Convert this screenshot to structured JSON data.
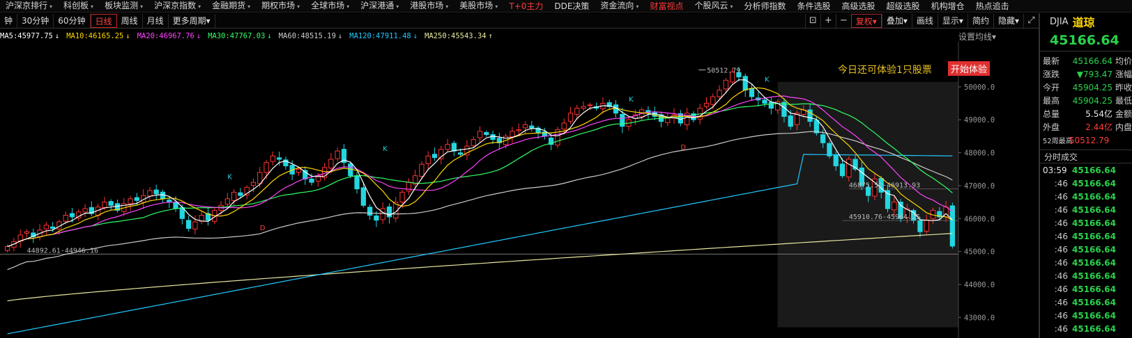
{
  "menu": [
    {
      "label": "沪深京排行",
      "caret": true
    },
    {
      "label": "科创板",
      "caret": true
    },
    {
      "label": "板块监测",
      "caret": true
    },
    {
      "label": "沪深京指数",
      "caret": true
    },
    {
      "label": "金融期货",
      "caret": true
    },
    {
      "label": "期权市场",
      "caret": true
    },
    {
      "label": "全球市场",
      "caret": true
    },
    {
      "label": "沪深港通",
      "caret": true
    },
    {
      "label": "港股市场",
      "caret": true
    },
    {
      "label": "美股市场",
      "caret": true
    },
    {
      "label": "T+0主力",
      "caret": false,
      "red": true
    },
    {
      "label": "DDE决策",
      "caret": false
    },
    {
      "label": "资金流向",
      "caret": true
    },
    {
      "label": "财富视点",
      "caret": false,
      "red": true
    },
    {
      "label": "个股风云",
      "caret": true
    },
    {
      "label": "分析师指数",
      "caret": false
    },
    {
      "label": "条件选股",
      "caret": false
    },
    {
      "label": "高级选股",
      "caret": false
    },
    {
      "label": "超级选股",
      "caret": false
    },
    {
      "label": "机构增仓",
      "caret": false
    },
    {
      "label": "热点追击",
      "caret": false
    }
  ],
  "toolbar": {
    "periods": [
      "钟",
      "30分钟",
      "60分钟",
      "日线",
      "周线",
      "月线",
      "更多周期"
    ],
    "active_period": "日线",
    "more_caret": "▾",
    "tools": [
      "复权",
      "叠加",
      "画线",
      "显示",
      "简约",
      "隐藏"
    ],
    "icons": {
      "lock": "⊡",
      "plus": "+",
      "minus": "−",
      "expand": "⤢"
    }
  },
  "ma_legend": [
    {
      "label": "MA5:45977.75",
      "arrow": "↓",
      "color": "#ffffff"
    },
    {
      "label": "MA10:46165.25",
      "arrow": "↓",
      "color": "#ffd700"
    },
    {
      "label": "MA20:46967.76",
      "arrow": "↓",
      "color": "#ff44ff"
    },
    {
      "label": "MA30:47767.03",
      "arrow": "↓",
      "color": "#33ff66"
    },
    {
      "label": "MA60:48515.19",
      "arrow": "↓",
      "color": "#cccccc"
    },
    {
      "label": "MA120:47911.48",
      "arrow": "↓",
      "color": "#22c8ff"
    },
    {
      "label": "MA250:45543.34",
      "arrow": "↑",
      "color": "#e8e8a0"
    }
  ],
  "ma_settings": "设置均线▾",
  "promo": {
    "text": "今日还可体验1只股票",
    "button": "开始体验"
  },
  "right_panel": {
    "code": "DJIA",
    "name": "道琼",
    "price": "45166.64",
    "stats": [
      {
        "label": "最新",
        "value": "45166.64",
        "color": "green",
        "next": "均价"
      },
      {
        "label": "涨跌",
        "value": "▼793.47",
        "color": "green",
        "next": "涨幅"
      },
      {
        "label": "今开",
        "value": "45904.25",
        "color": "green",
        "next": "昨收"
      },
      {
        "label": "最高",
        "value": "45904.25",
        "color": "green",
        "next": "最低"
      },
      {
        "label": "总量",
        "value": "5.54亿",
        "color": "white",
        "next": "金额"
      },
      {
        "label": "外盘",
        "value": "2.44亿",
        "color": "red",
        "next": "内盘"
      },
      {
        "label": "52周最高",
        "value": "50512.79",
        "color": "red",
        "next": ""
      }
    ],
    "ticks_title": "分时成交",
    "ticks": [
      {
        "time": "03:59",
        "price": "45166.64"
      },
      {
        "time": ":46",
        "price": "45166.64"
      },
      {
        "time": ":46",
        "price": "45166.64"
      },
      {
        "time": ":46",
        "price": "45166.64"
      },
      {
        "time": ":46",
        "price": "45166.64"
      },
      {
        "time": ":46",
        "price": "45166.64"
      },
      {
        "time": ":46",
        "price": "45166.64"
      },
      {
        "time": ":46",
        "price": "45166.64"
      },
      {
        "time": ":46",
        "price": "45166.64"
      },
      {
        "time": ":46",
        "price": "45166.64"
      },
      {
        "time": ":46",
        "price": "45166.64"
      },
      {
        "time": ":46",
        "price": "45166.64"
      },
      {
        "time": ":46",
        "price": "45166.64"
      }
    ]
  },
  "chart_data": {
    "type": "candlestick",
    "ylim": [
      42500,
      51200
    ],
    "yticks": [
      "50000.0",
      "49000.0",
      "48000.0",
      "47000.0",
      "46000.0",
      "45000.0",
      "44000.0",
      "43000.0"
    ],
    "ytick_values": [
      50000,
      49000,
      48000,
      47000,
      46000,
      45000,
      44000,
      43000
    ],
    "annotations": [
      {
        "text": "50512.79",
        "value": 50512.79
      },
      {
        "text": "44892.61-44946.16",
        "value": 44920
      },
      {
        "text": "46875.52-46913.93",
        "value": 46900
      },
      {
        "text": "45910.76-45964.25",
        "value": 45940
      }
    ],
    "markers": [
      {
        "text": "K",
        "kind": "buy"
      },
      {
        "text": "D",
        "kind": "sell"
      },
      {
        "text": "K",
        "kind": "buy"
      },
      {
        "text": "K",
        "kind": "buy"
      },
      {
        "text": "K",
        "kind": "buy"
      },
      {
        "text": "D",
        "kind": "sell"
      }
    ],
    "closes": [
      45150,
      45300,
      45500,
      45600,
      45450,
      45650,
      45800,
      45700,
      45900,
      46100,
      46050,
      46200,
      46300,
      46150,
      46350,
      46500,
      46400,
      46250,
      46450,
      46600,
      46550,
      46700,
      46850,
      46750,
      46600,
      46500,
      46300,
      46000,
      45700,
      45900,
      46100,
      45950,
      46250,
      46400,
      46600,
      46800,
      46700,
      46950,
      47100,
      47400,
      47700,
      47900,
      47800,
      47600,
      47350,
      47500,
      47200,
      47100,
      47300,
      47550,
      47800,
      48050,
      47700,
      47300,
      46900,
      46400,
      46100,
      45950,
      46300,
      46050,
      46500,
      46800,
      47100,
      47300,
      47650,
      47900,
      47850,
      48100,
      48250,
      48050,
      47950,
      48200,
      48400,
      48650,
      48550,
      48400,
      48300,
      48500,
      48650,
      48700,
      48850,
      48750,
      48600,
      48500,
      48250,
      48700,
      48900,
      49200,
      49350,
      49400,
      49450,
      49350,
      49500,
      49400,
      49200,
      48800,
      49000,
      49150,
      49300,
      49200,
      49100,
      48950,
      49050,
      49150,
      48900,
      49200,
      49000,
      49350,
      49500,
      49700,
      49900,
      50200,
      50450,
      50300,
      49900,
      49700,
      49600,
      49500,
      49350,
      49550,
      49100,
      48800,
      49200,
      49300,
      48950,
      48600,
      48300,
      47900,
      47600,
      47300,
      47800,
      47500,
      47000,
      46700,
      47200,
      46800,
      46300,
      46500,
      46000,
      46300,
      45950,
      45600,
      45950,
      46250,
      46050,
      46350,
      45166
    ]
  }
}
